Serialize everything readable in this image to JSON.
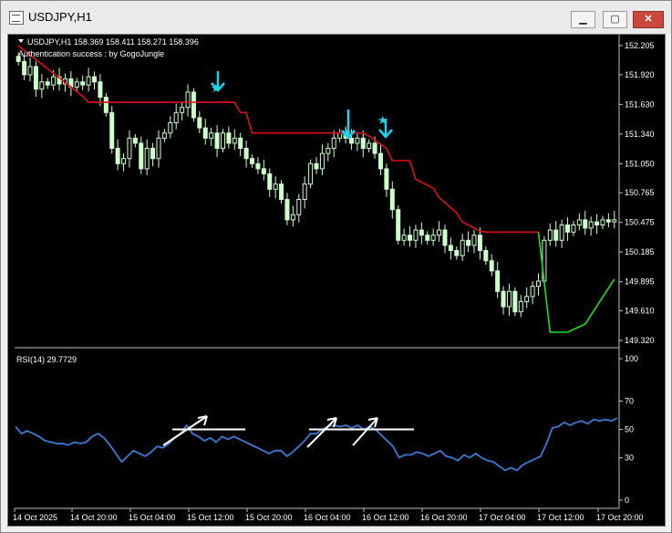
{
  "window": {
    "title": "USDJPY,H1",
    "buttons": {
      "minimize": "▁",
      "maximize": "▢",
      "close": "✕"
    }
  },
  "main_panel": {
    "header": "USDJPY,H1  158.369 158.411 158.271 158.396",
    "subheader": "Authentication success : by GogoJungle",
    "price_ticks": [
      "152.205",
      "151.920",
      "151.630",
      "151.340",
      "151.050",
      "150.765",
      "150.475",
      "150.185",
      "149.895",
      "149.610",
      "149.320"
    ]
  },
  "rsi_panel": {
    "header": "RSI(14) 29.7729",
    "ticks": [
      "100",
      "70",
      "50",
      "30",
      "0"
    ]
  },
  "time_axis": [
    "14 Oct 2025",
    "14 Oct 20:00",
    "15 Oct 04:00",
    "15 Oct 12:00",
    "15 Oct 20:00",
    "16 Oct 04:00",
    "16 Oct 12:00",
    "16 Oct 20:00",
    "17 Oct 04:00",
    "17 Oct 12:00",
    "17 Oct 20:00"
  ],
  "colors": {
    "background": "#000000",
    "candle": "#ccffcc",
    "resistance_line": "#dd1111",
    "support_line": "#22dd22",
    "rsi_line": "#3a7bd5",
    "signal_arrow": "#1ad4f0",
    "annotation": "#ffffff"
  },
  "chart_data": [
    {
      "type": "candlestick",
      "symbol": "USDJPY",
      "timeframe": "H1",
      "ylim": [
        149.32,
        152.205
      ],
      "close": [
        152.05,
        151.92,
        152.0,
        151.78,
        151.85,
        151.82,
        151.9,
        151.83,
        151.88,
        151.8,
        151.85,
        151.82,
        151.9,
        151.85,
        151.7,
        151.55,
        151.2,
        151.05,
        151.1,
        151.3,
        151.25,
        151.0,
        151.2,
        151.1,
        151.3,
        151.35,
        151.45,
        151.55,
        151.6,
        151.75,
        151.5,
        151.4,
        151.3,
        151.35,
        151.2,
        151.35,
        151.25,
        151.3,
        151.2,
        151.1,
        151.05,
        151.0,
        150.95,
        150.8,
        150.85,
        150.7,
        150.5,
        150.55,
        150.7,
        150.85,
        151.05,
        151.0,
        151.15,
        151.2,
        151.3,
        151.35,
        151.3,
        151.25,
        151.3,
        151.2,
        151.25,
        151.15,
        151.0,
        150.8,
        150.6,
        150.3,
        150.35,
        150.3,
        150.4,
        150.35,
        150.3,
        150.35,
        150.4,
        150.25,
        150.2,
        150.15,
        150.3,
        150.25,
        150.35,
        150.2,
        150.1,
        150.0,
        149.8,
        149.65,
        149.8,
        149.6,
        149.7,
        149.75,
        149.85,
        149.9,
        150.3,
        150.4,
        150.3,
        150.45,
        150.38,
        150.45,
        150.5,
        150.42,
        150.48,
        150.45,
        150.5,
        150.48,
        150.5
      ]
    },
    {
      "type": "line",
      "series": [
        {
          "values": [
            52,
            47,
            49,
            47,
            45,
            42,
            41,
            40,
            40,
            39,
            41,
            40,
            41,
            45,
            47,
            44,
            39,
            33,
            27,
            31,
            35,
            33,
            31,
            34,
            38,
            37,
            40,
            44,
            47,
            53,
            47,
            45,
            42,
            44,
            41,
            45,
            43,
            45,
            43,
            41,
            39,
            37,
            35,
            33,
            35,
            35,
            31,
            34,
            38,
            42,
            47,
            47,
            50,
            52,
            53,
            52,
            53,
            51,
            53,
            50,
            52,
            50,
            46,
            42,
            38,
            30,
            32,
            32,
            34,
            33,
            31,
            33,
            35,
            31,
            30,
            28,
            32,
            30,
            33,
            30,
            28,
            27,
            24,
            21,
            23,
            21,
            25,
            27,
            29,
            31,
            40,
            51,
            52,
            55,
            53,
            55,
            56,
            54,
            57,
            56,
            57,
            56,
            58
          ]
        }
      ],
      "ylim": [
        0,
        100
      ],
      "levels": [
        30,
        50,
        70
      ]
    }
  ]
}
